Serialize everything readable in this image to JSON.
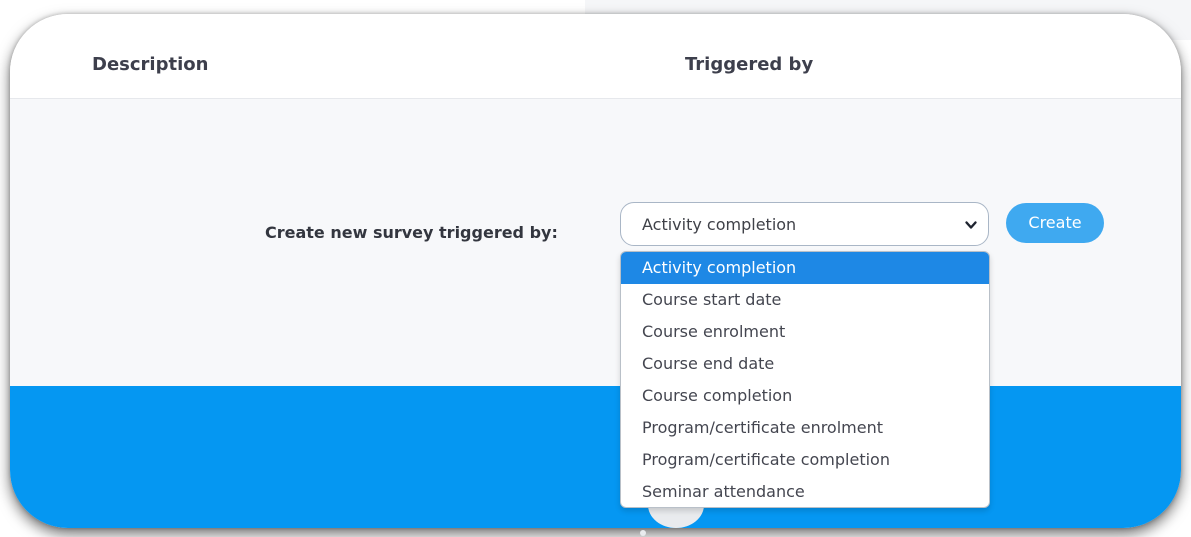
{
  "table_header": {
    "description": "Description",
    "triggered_by": "Triggered by"
  },
  "survey_form": {
    "label": "Create new survey triggered by:",
    "selected_value": "Activity completion",
    "create_button": "Create",
    "options": [
      "Activity completion",
      "Course start date",
      "Course enrolment",
      "Course end date",
      "Course completion",
      "Program/certificate enrolment",
      "Program/certificate completion",
      "Seminar attendance"
    ],
    "highlighted_option_index": 0
  },
  "colors": {
    "accent": "#0597f2",
    "button": "#3fa9f0",
    "highlight": "#1e88e5"
  },
  "icons": {
    "select_arrow": "chevron-down-icon"
  }
}
